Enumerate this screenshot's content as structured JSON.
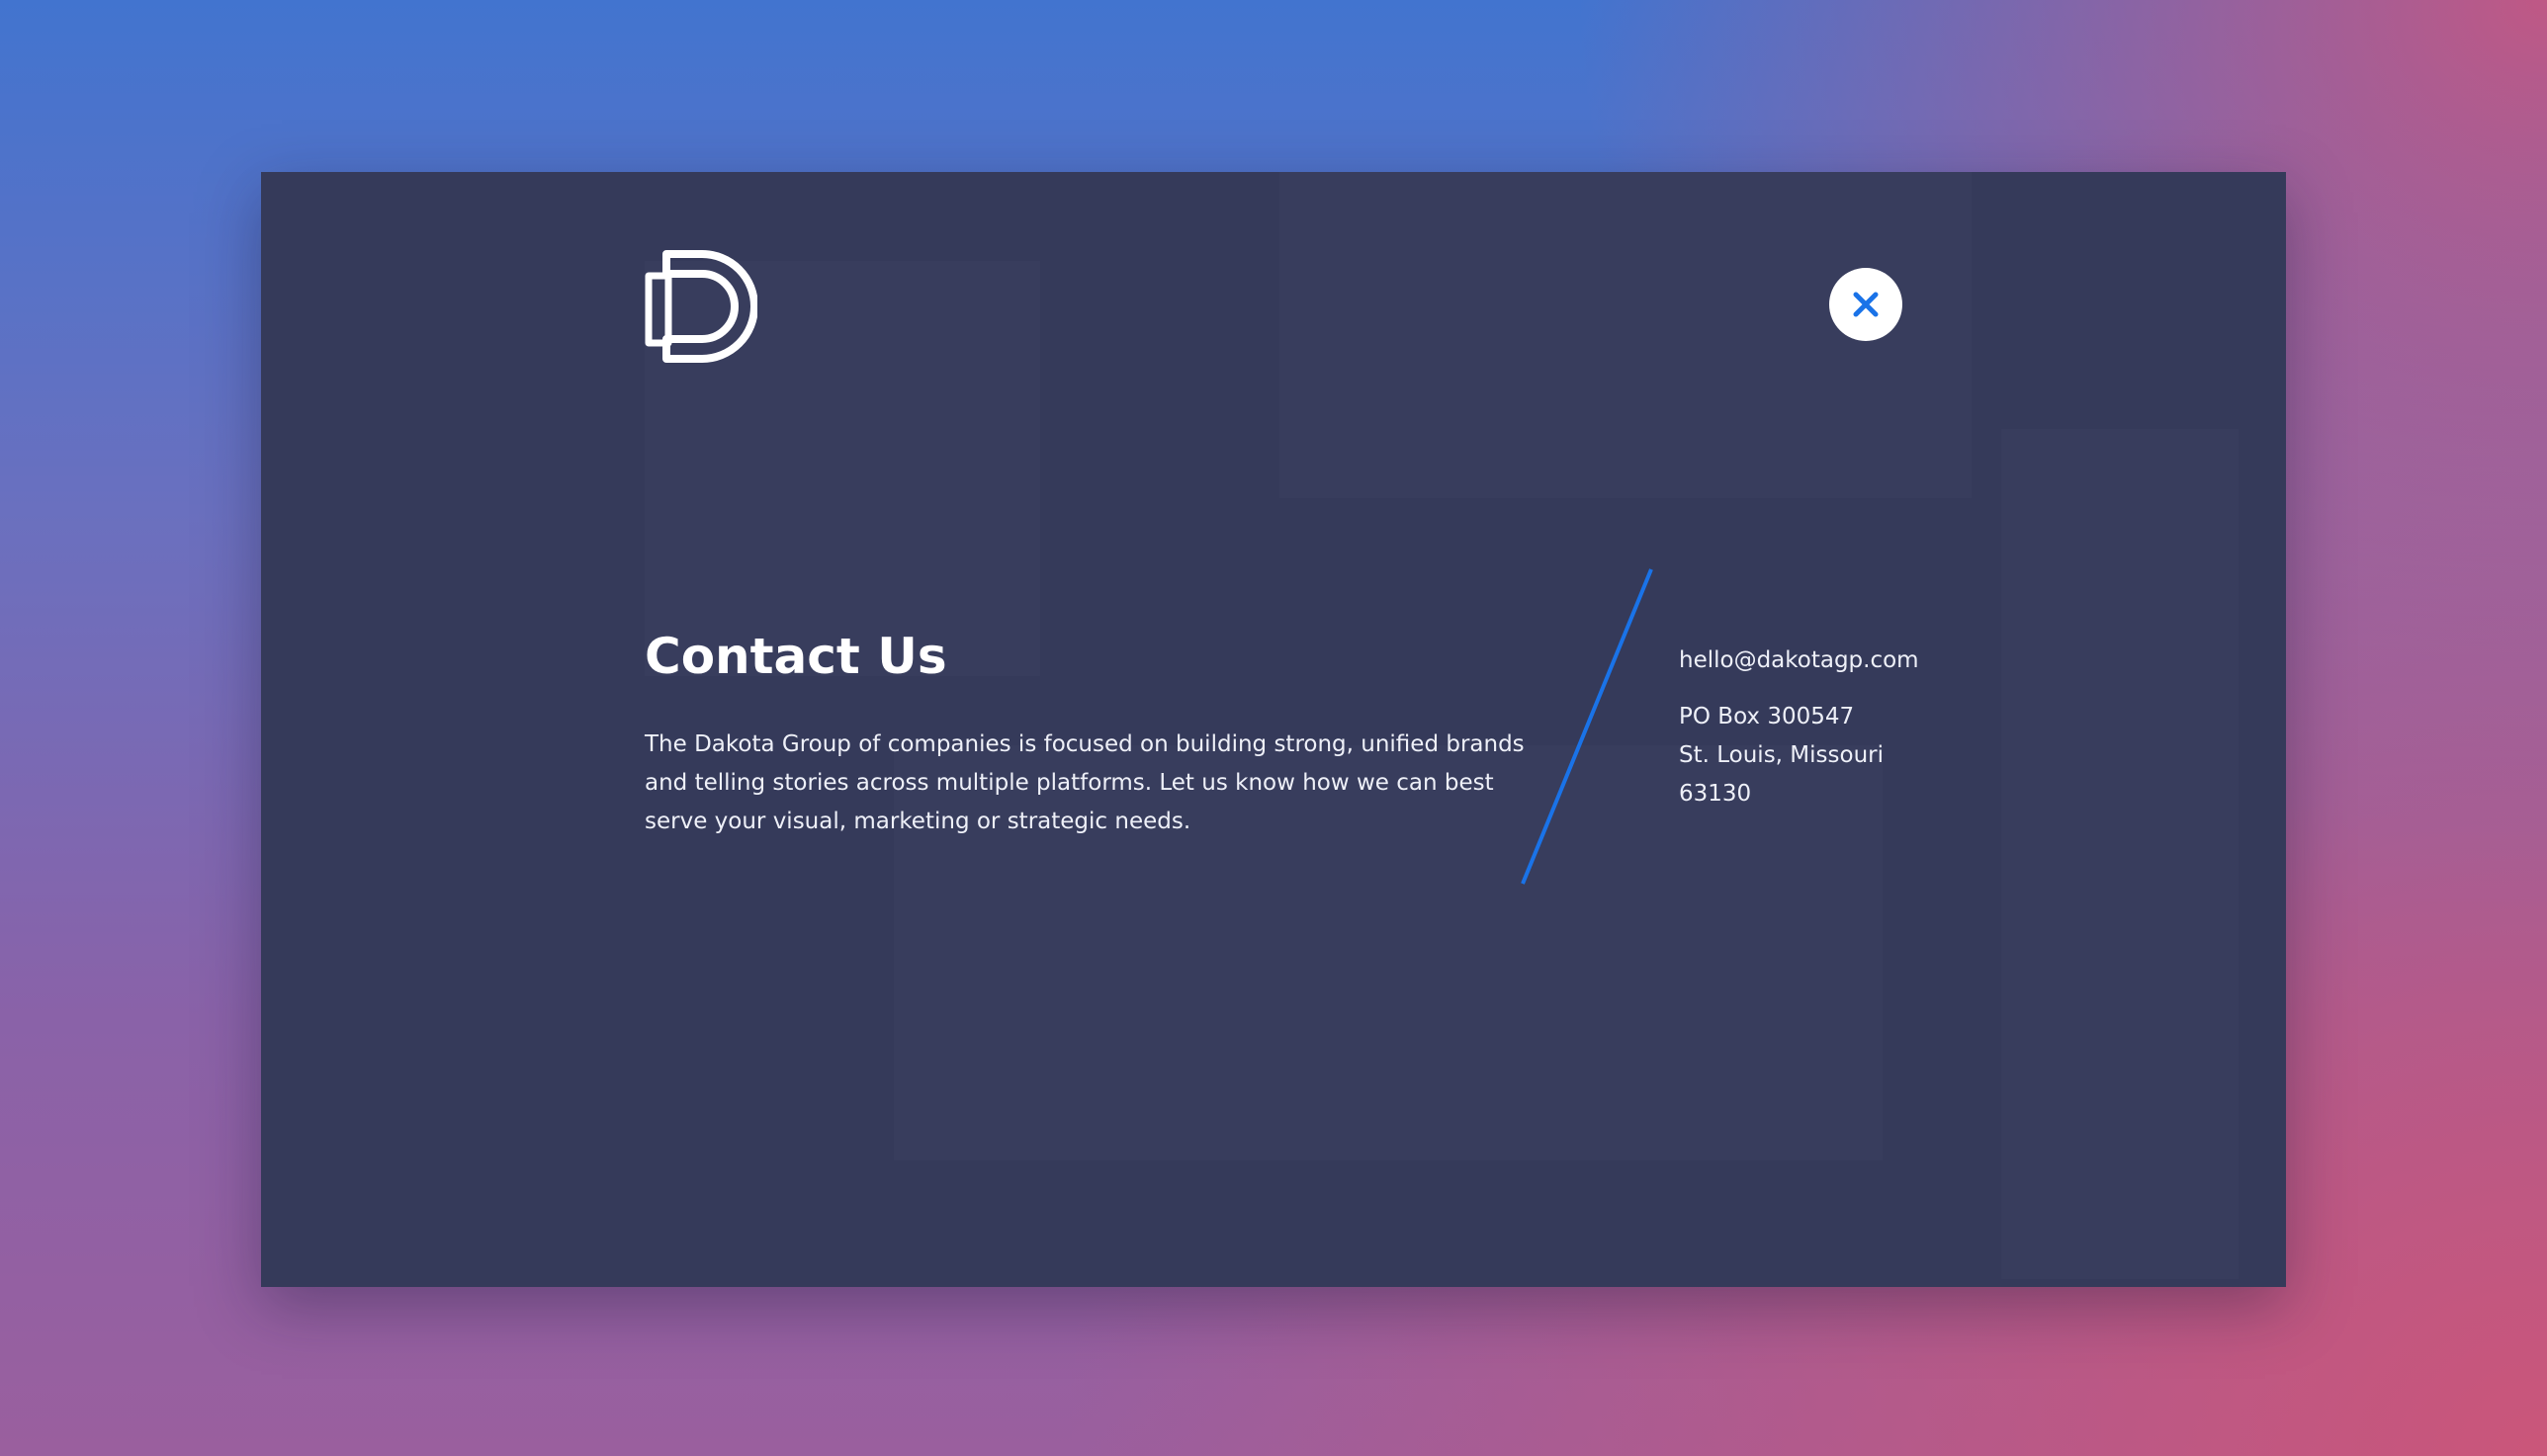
{
  "modal": {
    "title": "Contact Us",
    "description": "The Dakota Group of companies is focused on building strong, unified brands and telling stories across multiple platforms. Let us know how we can best serve your visual, marketing or strategic needs.",
    "contact": {
      "email": "hello@dakotagp.com",
      "address_lines": [
        "PO Box 300547",
        "St. Louis, Missouri",
        "63130"
      ]
    },
    "close_icon": "close-icon",
    "logo_icon": "dakota-d-logo"
  },
  "colors": {
    "modal_bg": "#353a5a",
    "accent": "#1a73e8",
    "text": "#ffffff",
    "close_button_bg": "#ffffff"
  }
}
